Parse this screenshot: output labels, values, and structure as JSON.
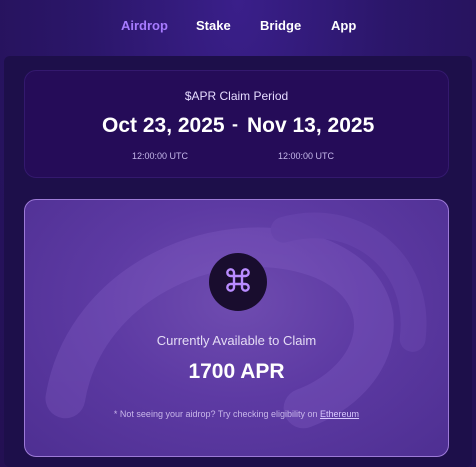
{
  "nav": {
    "items": [
      {
        "label": "Airdrop",
        "active": true
      },
      {
        "label": "Stake",
        "active": false
      },
      {
        "label": "Bridge",
        "active": false
      },
      {
        "label": "App",
        "active": false
      }
    ]
  },
  "claim_period": {
    "title": "$APR Claim Period",
    "start_date": "Oct 23, 2025",
    "separator": "-",
    "end_date": "Nov 13, 2025",
    "start_time": "12:00:00 UTC",
    "end_time": "12:00:00 UTC"
  },
  "claim": {
    "logo_icon": "command-icon",
    "label": "Currently Available to Claim",
    "amount": "1700 APR",
    "footnote_text": "* Not seeing your aidrop? Try checking eligibility on ",
    "footnote_link": "Ethereum"
  },
  "colors": {
    "accent": "#a77bff",
    "background": "#2a1462",
    "card_dark": "#250c58",
    "card_purple": "#5d3aa3"
  }
}
